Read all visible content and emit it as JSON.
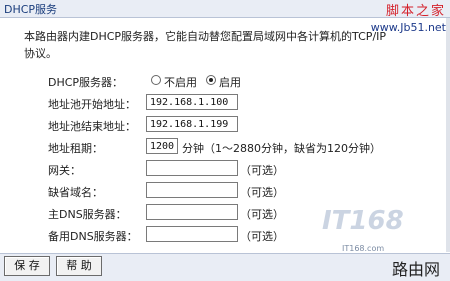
{
  "window": {
    "title": "DHCP服务"
  },
  "site": {
    "logo": "脚本之家",
    "url": "www.Jb51.net"
  },
  "description": "本路由器内建DHCP服务器，它能自动替您配置局域网中各计算机的TCP/IP协议。",
  "form": {
    "dhcp_server": {
      "label": "DHCP服务器：",
      "options": [
        "不启用",
        "启用"
      ],
      "selected": "启用"
    },
    "pool_start": {
      "label": "地址池开始地址：",
      "value": "192.168.1.100"
    },
    "pool_end": {
      "label": "地址池结束地址：",
      "value": "192.168.1.199"
    },
    "lease": {
      "label": "地址租期：",
      "value": "1200",
      "note": "分钟（1～2880分钟，缺省为120分钟）"
    },
    "gateway": {
      "label": "网关：",
      "value": "",
      "note": "（可选）"
    },
    "domain": {
      "label": "缺省域名：",
      "value": "",
      "note": "（可选）"
    },
    "primary_dns": {
      "label": "主DNS服务器：",
      "value": "",
      "note": "（可选）"
    },
    "secondary_dns": {
      "label": "备用DNS服务器：",
      "value": "",
      "note": "（可选）"
    }
  },
  "buttons": {
    "save": "保 存",
    "help": "帮 助"
  },
  "watermarks": {
    "it168": "IT168",
    "it168_url": "IT168.com",
    "luyou": "路由网"
  }
}
